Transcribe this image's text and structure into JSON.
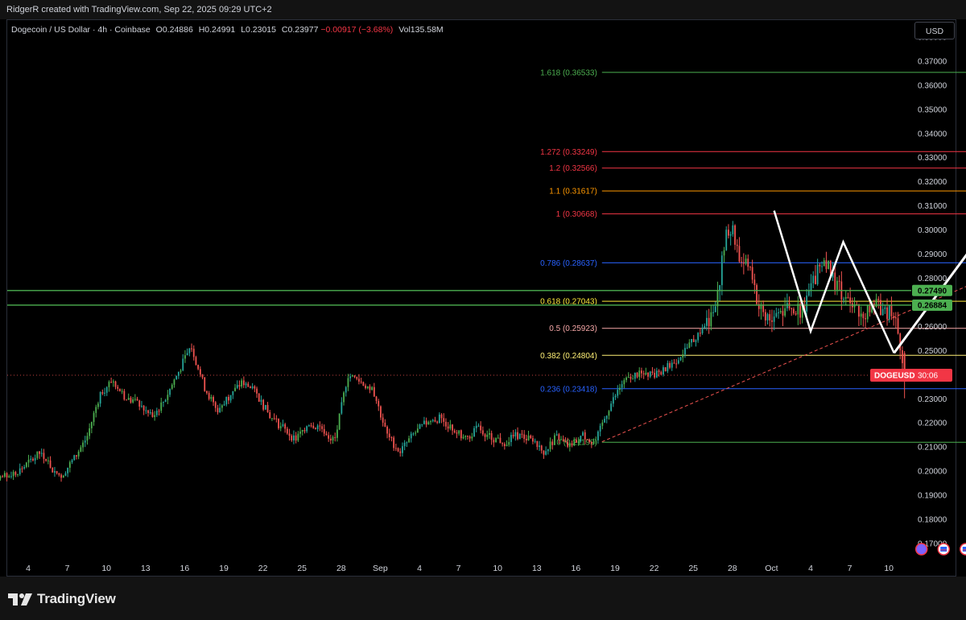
{
  "header": {
    "attribution": "RidgerR created with TradingView.com, Sep 22, 2025 09:29 UTC+2"
  },
  "legend": {
    "symbol": "Dogecoin / US Dollar · 4h · Coinbase",
    "open": "O0.24886",
    "high": "H0.24991",
    "low": "L0.23015",
    "close": "C0.23977",
    "change": "−0.00917 (−3.68%)",
    "volume": "Vol135.58M"
  },
  "currency_button": "USD",
  "footer": {
    "brand": "TradingView"
  },
  "colors": {
    "up": "#26a69a",
    "up_bright": "#4caf50",
    "down": "#ef5350",
    "background": "#000000",
    "grid_text": "#d1d4dc",
    "support_line": "#4caf50",
    "price_tag": "#f23645"
  },
  "chart_data": {
    "type": "candlestick",
    "symbol": "DOGEUSD",
    "timeframe": "4h",
    "ylim": [
      0.165,
      0.387
    ],
    "y_ticks": [
      0.17,
      0.18,
      0.19,
      0.2,
      0.21,
      0.22,
      0.23,
      0.24,
      0.25,
      0.26,
      0.27,
      0.28,
      0.29,
      0.3,
      0.31,
      0.32,
      0.33,
      0.34,
      0.35,
      0.36,
      0.37,
      0.38
    ],
    "x_ticks": [
      "4",
      "7",
      "10",
      "13",
      "16",
      "19",
      "22",
      "25",
      "28",
      "Sep",
      "4",
      "7",
      "10",
      "13",
      "16",
      "19",
      "22",
      "25",
      "28",
      "Oct",
      "4",
      "7",
      "10"
    ],
    "x_tick_days": [
      -45,
      -42,
      -39,
      -36,
      -33,
      -30,
      -27,
      -24,
      -21,
      -18,
      -15,
      -12,
      -9,
      -6,
      -3,
      0,
      3,
      6,
      9,
      12,
      15,
      18,
      21
    ],
    "x_unit": "days from Sep 19, 2025",
    "path_points": [
      [
        -48.3,
        0.19
      ],
      [
        -47,
        0.197
      ],
      [
        -45.5,
        0.201
      ],
      [
        -44,
        0.208
      ],
      [
        -43,
        0.2
      ],
      [
        -42.5,
        0.198
      ],
      [
        -41.5,
        0.205
      ],
      [
        -40.5,
        0.214
      ],
      [
        -39.5,
        0.232
      ],
      [
        -38.5,
        0.238
      ],
      [
        -37.5,
        0.23
      ],
      [
        -36.5,
        0.228
      ],
      [
        -35.5,
        0.222
      ],
      [
        -34.5,
        0.23
      ],
      [
        -33.5,
        0.241
      ],
      [
        -32.5,
        0.252
      ],
      [
        -31.5,
        0.235
      ],
      [
        -30.5,
        0.225
      ],
      [
        -29.5,
        0.232
      ],
      [
        -28.5,
        0.237
      ],
      [
        -27.5,
        0.232
      ],
      [
        -26.5,
        0.223
      ],
      [
        -25.5,
        0.218
      ],
      [
        -24.5,
        0.213
      ],
      [
        -23.5,
        0.22
      ],
      [
        -22.5,
        0.218
      ],
      [
        -21.5,
        0.212
      ],
      [
        -20.5,
        0.24
      ],
      [
        -19.5,
        0.237
      ],
      [
        -18.5,
        0.233
      ],
      [
        -17.5,
        0.215
      ],
      [
        -16.5,
        0.208
      ],
      [
        -15.5,
        0.215
      ],
      [
        -14.5,
        0.22
      ],
      [
        -13.5,
        0.222
      ],
      [
        -12.5,
        0.218
      ],
      [
        -11.5,
        0.213
      ],
      [
        -10.5,
        0.218
      ],
      [
        -9.5,
        0.214
      ],
      [
        -8.5,
        0.212
      ],
      [
        -7.5,
        0.215
      ],
      [
        -6.5,
        0.213
      ],
      [
        -5.5,
        0.208
      ],
      [
        -4.5,
        0.214
      ],
      [
        -3.5,
        0.21
      ],
      [
        -2.5,
        0.215
      ],
      [
        -1.5,
        0.212
      ],
      [
        -0.5,
        0.226
      ],
      [
        0.5,
        0.236
      ],
      [
        1.5,
        0.24
      ],
      [
        2.5,
        0.24
      ],
      [
        3.5,
        0.241
      ],
      [
        4.5,
        0.245
      ],
      [
        5.5,
        0.251
      ],
      [
        6.5,
        0.258
      ],
      [
        7.5,
        0.266
      ],
      [
        8,
        0.279
      ],
      [
        8.5,
        0.297
      ],
      [
        9,
        0.301
      ],
      [
        9.5,
        0.289
      ],
      [
        10.5,
        0.283
      ],
      [
        11,
        0.268
      ],
      [
        12,
        0.263
      ],
      [
        13,
        0.268
      ],
      [
        14,
        0.266
      ],
      [
        14.5,
        0.269
      ],
      [
        15.5,
        0.283
      ],
      [
        16,
        0.288
      ],
      [
        17,
        0.277
      ],
      [
        18,
        0.268
      ],
      [
        19,
        0.266
      ],
      [
        20,
        0.268
      ],
      [
        21,
        0.266
      ],
      [
        21.5,
        0.262
      ],
      [
        22,
        0.25
      ],
      [
        22.2,
        0.2398
      ]
    ],
    "fibonacci_levels": [
      {
        "label": "1.618 (0.36533)",
        "value": 0.36533,
        "color": "#4caf50"
      },
      {
        "label": "1.272 (0.33249)",
        "value": 0.33249,
        "color": "#f23645"
      },
      {
        "label": "1.2 (0.32566)",
        "value": 0.32566,
        "color": "#f23645"
      },
      {
        "label": "1.1 (0.31617)",
        "value": 0.31617,
        "color": "#ff9800"
      },
      {
        "label": "1 (0.30668)",
        "value": 0.30668,
        "color": "#f23645"
      },
      {
        "label": "0.786 (0.28637)",
        "value": 0.28637,
        "color": "#2962ff"
      },
      {
        "label": "0.618 (0.27043)",
        "value": 0.27043,
        "color": "#ffeb3b"
      },
      {
        "label": "0.5 (0.25923)",
        "value": 0.25923,
        "color": "#f7a8a8"
      },
      {
        "label": "0.382 (0.24804)",
        "value": 0.24804,
        "color": "#fff176"
      },
      {
        "label": "0.236 (0.23418)",
        "value": 0.23418,
        "color": "#2962ff"
      },
      {
        "label": "0 (0.21199)",
        "value": 0.21199,
        "color": "#4caf50"
      }
    ],
    "fib_range_days": [
      -1.0,
      40.0
    ],
    "horizontal_levels": [
      {
        "label": "0.27490",
        "value": 0.2749
      },
      {
        "label": "0.26884",
        "value": 0.26884
      }
    ],
    "current_price": {
      "label": "DOGEUSD",
      "countdown": "30:06",
      "value": 0.23977
    },
    "trendline": {
      "from": [
        -1.0,
        0.2122
      ],
      "to": [
        40.0,
        0.3067
      ]
    },
    "w_pattern": [
      [
        12.2,
        0.308
      ],
      [
        16.2,
        0.258
      ],
      [
        19.2,
        0.295
      ],
      [
        23.2,
        0.249
      ]
    ],
    "projection_arrow": {
      "from": [
        23.2,
        0.249
      ],
      "to": [
        39.0,
        0.378
      ]
    },
    "events_at_day": [
      23.5,
      25.2,
      26.9,
      27.8
    ],
    "x_window": [
      -49,
      22.3
    ]
  }
}
